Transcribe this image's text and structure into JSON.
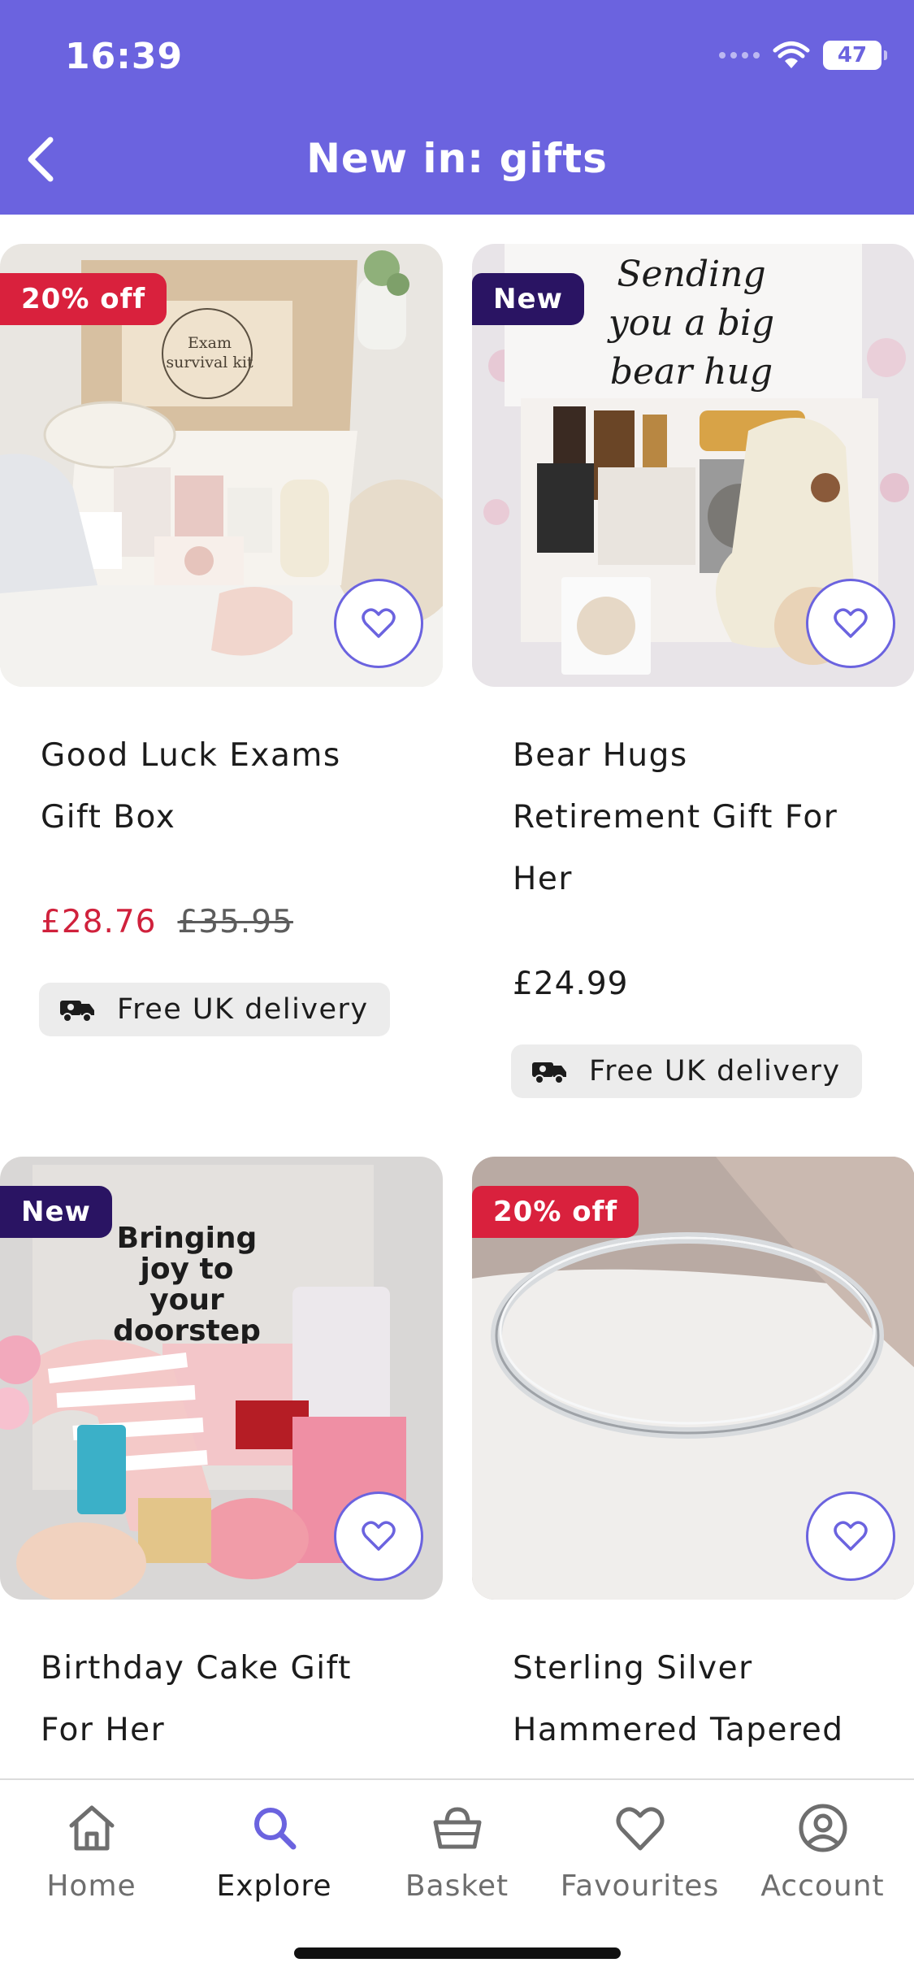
{
  "status_bar": {
    "time": "16:39",
    "battery": "47"
  },
  "header": {
    "title": "New in: gifts",
    "back_icon": "chevron-left-icon"
  },
  "colors": {
    "brand": "#6b63df",
    "sale": "#d9213d",
    "new_badge": "#2a1463"
  },
  "products": [
    {
      "badge": "20% off",
      "title_lines": [
        "Good Luck Exams",
        "Gift Box"
      ],
      "price": "£28.76",
      "was_price": "£35.95",
      "delivery": "Free UK delivery",
      "image_text": [
        "Exam",
        "survival kit"
      ]
    },
    {
      "badge": "New",
      "title_lines": [
        "Bear Hugs",
        "Retirement Gift For",
        "Her"
      ],
      "price": "£24.99",
      "delivery": "Free UK delivery",
      "image_text": [
        "Sending",
        "you a big",
        "bear hug"
      ]
    },
    {
      "badge": "New",
      "title_lines": [
        "Birthday Cake Gift",
        "For Her"
      ],
      "image_text": [
        "Bringing",
        "joy to",
        "your",
        "doorstep"
      ]
    },
    {
      "badge": "20% off",
      "title_lines": [
        "Sterling Silver",
        "Hammered Tapered"
      ]
    }
  ],
  "bottom_nav": [
    {
      "label": "Home",
      "icon": "home-icon",
      "active": false
    },
    {
      "label": "Explore",
      "icon": "search-icon",
      "active": true
    },
    {
      "label": "Basket",
      "icon": "basket-icon",
      "active": false
    },
    {
      "label": "Favourites",
      "icon": "heart-icon",
      "active": false
    },
    {
      "label": "Account",
      "icon": "account-icon",
      "active": false
    }
  ]
}
